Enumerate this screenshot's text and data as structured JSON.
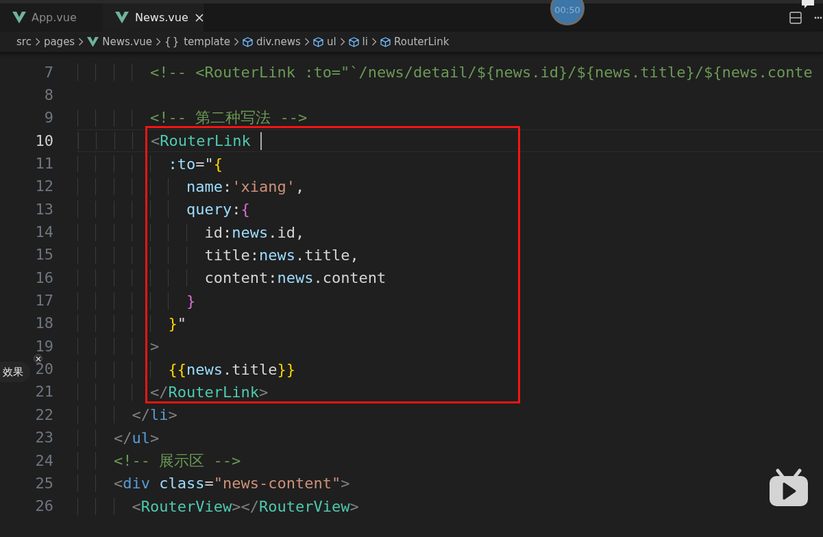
{
  "tabs": [
    {
      "label": "App.vue",
      "kind": "vue",
      "selected": false
    },
    {
      "label": "News.vue",
      "kind": "vue",
      "selected": true
    }
  ],
  "breadcrumb": [
    {
      "label": "src",
      "kind": "folder"
    },
    {
      "label": "pages",
      "kind": "folder"
    },
    {
      "label": "News.vue",
      "kind": "vue"
    },
    {
      "label": "template",
      "kind": "symbol",
      "glyph": "{}"
    },
    {
      "label": "div.news",
      "kind": "element"
    },
    {
      "label": "ul",
      "kind": "element"
    },
    {
      "label": "li",
      "kind": "element"
    },
    {
      "label": "RouterLink",
      "kind": "element"
    }
  ],
  "editor": {
    "lines": [
      {
        "number": "7",
        "cursor": false,
        "tokens": [
          {
            "kind": "comment",
            "text": "        <!-- <RouterLink :to=\"`/news/detail/${news.id}/${news.title}/${news.conte"
          }
        ]
      },
      {
        "number": "8",
        "cursor": false
      },
      {
        "number": "9",
        "cursor": false,
        "tokens": [
          {
            "kind": "comment",
            "text": "        <!-- 第二种写法 -->"
          }
        ]
      },
      {
        "number": "10",
        "cursor": true,
        "tokens": [
          {
            "kind": "punct",
            "text": "        <"
          },
          {
            "kind": "component",
            "text": "RouterLink"
          }
        ]
      },
      {
        "number": "11",
        "cursor": false,
        "tokens": [
          {
            "kind": "attr",
            "text": "          :to"
          },
          {
            "kind": "plain",
            "text": "=\""
          },
          {
            "kind": "brace1",
            "text": "{"
          }
        ]
      },
      {
        "number": "12",
        "cursor": false,
        "tokens": [
          {
            "kind": "attr",
            "text": "            name"
          },
          {
            "kind": "plain",
            "text": ":"
          },
          {
            "kind": "string",
            "text": "'xiang'"
          },
          {
            "kind": "plain",
            "text": ","
          }
        ]
      },
      {
        "number": "13",
        "cursor": false,
        "tokens": [
          {
            "kind": "attr",
            "text": "            query"
          },
          {
            "kind": "plain",
            "text": ":"
          },
          {
            "kind": "brace2",
            "text": "{"
          }
        ]
      },
      {
        "number": "14",
        "cursor": false,
        "tokens": [
          {
            "kind": "plain",
            "text": "              id:"
          },
          {
            "kind": "var",
            "text": "news"
          },
          {
            "kind": "plain",
            "text": ".id,"
          }
        ]
      },
      {
        "number": "15",
        "cursor": false,
        "tokens": [
          {
            "kind": "plain",
            "text": "              title:"
          },
          {
            "kind": "var",
            "text": "news"
          },
          {
            "kind": "plain",
            "text": ".title,"
          }
        ]
      },
      {
        "number": "16",
        "cursor": false,
        "tokens": [
          {
            "kind": "plain",
            "text": "              content:"
          },
          {
            "kind": "var",
            "text": "news"
          },
          {
            "kind": "plain",
            "text": ".content"
          }
        ]
      },
      {
        "number": "17",
        "cursor": false,
        "tokens": [
          {
            "kind": "brace2",
            "text": "            }"
          }
        ]
      },
      {
        "number": "18",
        "cursor": false,
        "tokens": [
          {
            "kind": "brace1",
            "text": "          }"
          },
          {
            "kind": "plain",
            "text": "\""
          }
        ]
      },
      {
        "number": "19",
        "cursor": false,
        "tokens": [
          {
            "kind": "punct",
            "text": "        >"
          }
        ]
      },
      {
        "number": "20",
        "cursor": false,
        "tokens": [
          {
            "kind": "brace1",
            "text": "          {{"
          },
          {
            "kind": "var",
            "text": "news"
          },
          {
            "kind": "plain",
            "text": ".title"
          },
          {
            "kind": "brace1",
            "text": "}}"
          }
        ]
      },
      {
        "number": "21",
        "cursor": false,
        "tokens": [
          {
            "kind": "punct",
            "text": "        </"
          },
          {
            "kind": "component",
            "text": "RouterLink"
          },
          {
            "kind": "punct",
            "text": ">"
          }
        ]
      },
      {
        "number": "22",
        "cursor": false,
        "tokens": [
          {
            "kind": "punct",
            "text": "      </"
          },
          {
            "kind": "tag",
            "text": "li"
          },
          {
            "kind": "punct",
            "text": ">"
          }
        ]
      },
      {
        "number": "23",
        "cursor": false,
        "tokens": [
          {
            "kind": "punct",
            "text": "    </"
          },
          {
            "kind": "tag",
            "text": "ul"
          },
          {
            "kind": "punct",
            "text": ">"
          }
        ]
      },
      {
        "number": "24",
        "cursor": false,
        "tokens": [
          {
            "kind": "comment",
            "text": "    <!-- 展示区 -->"
          }
        ]
      },
      {
        "number": "25",
        "cursor": false,
        "tokens": [
          {
            "kind": "punct",
            "text": "    <"
          },
          {
            "kind": "tag",
            "text": "div"
          },
          {
            "kind": "attr",
            "text": " class"
          },
          {
            "kind": "plain",
            "text": "="
          },
          {
            "kind": "string",
            "text": "\"news-content\""
          },
          {
            "kind": "punct",
            "text": ">"
          }
        ]
      },
      {
        "number": "26",
        "cursor": false,
        "tokens": [
          {
            "kind": "punct",
            "text": "      <"
          },
          {
            "kind": "component",
            "text": "RouterView"
          },
          {
            "kind": "punct",
            "text": "></"
          },
          {
            "kind": "component",
            "text": "RouterView"
          },
          {
            "kind": "punct",
            "text": ">"
          }
        ]
      }
    ]
  },
  "timer": {
    "label": "00:50"
  },
  "popup": {
    "label": "效果"
  }
}
